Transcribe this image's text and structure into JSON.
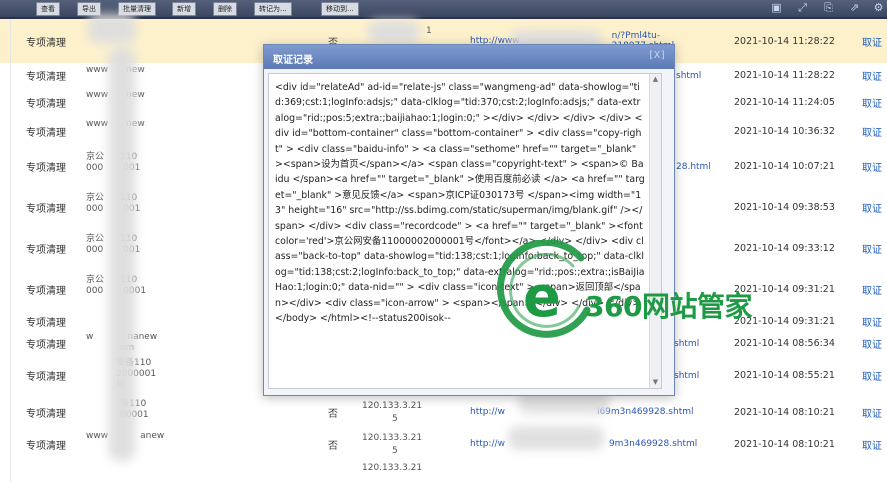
{
  "toolbar": {
    "buttons": [
      "查看",
      "导出",
      "批量清理",
      "新增",
      "删除",
      "转记为...",
      "移动到..."
    ],
    "icons": [
      "save-icon",
      "expand-icon",
      "export-icon",
      "share-icon",
      "settings-icon"
    ]
  },
  "rows": [
    {
      "type": "专项清理",
      "src": "",
      "flag": "否",
      "ip": "",
      "ip2": "1",
      "url": "http://www",
      "url_end": "n/?Pml4tu-218977.shtml",
      "time": "2021-10-14 11:28:22",
      "action": "取证"
    },
    {
      "type": "专项清理",
      "src": "www",
      "src2": "new",
      "flag": "",
      "ip": "",
      "ip2": "",
      "url": "",
      "url_end": "shtml",
      "time": "2021-10-14 11:28:22",
      "action": "取证"
    },
    {
      "type": "专项清理",
      "src": "www",
      "src2": "new",
      "flag": "",
      "ip": "",
      "ip2": "",
      "url": "",
      "url_end": "",
      "time": "2021-10-14 11:24:05",
      "action": "取证"
    },
    {
      "type": "专项清理",
      "src": "www",
      "src2": "new",
      "flag": "",
      "ip": "",
      "ip2": "",
      "url": "",
      "url_end": "",
      "time": "2021-10-14 10:36:32",
      "action": "取证"
    },
    {
      "type": "专项清理",
      "src": "京公",
      "src2": "110",
      "src3": "000",
      "src4": "001",
      "flag": "",
      "ip": "",
      "ip2": "",
      "url": "",
      "url_end": "28.html",
      "time": "2021-10-14 10:07:21",
      "action": "取证"
    },
    {
      "type": "专项清理",
      "src": "京公",
      "src2": "110",
      "src3": "000",
      "src4": "001",
      "flag": "",
      "ip": "",
      "ip2": "",
      "url": "",
      "url_end": "",
      "time": "2021-10-14 09:38:53",
      "action": "取证"
    },
    {
      "type": "专项清理",
      "src": "京公",
      "src2": "110",
      "src3": "000",
      "src4": "001",
      "flag": "",
      "ip": "",
      "ip2": "",
      "url": "",
      "url_end": "",
      "time": "2021-10-14 09:33:12",
      "action": "取证"
    },
    {
      "type": "专项清理",
      "src": "京公",
      "src2": "110",
      "src3": "000",
      "src4": "0001",
      "flag": "",
      "ip": "",
      "ip2": "",
      "url": "",
      "url_end": "",
      "time": "2021-10-14 09:31:21",
      "action": "取证"
    },
    {
      "type": "专项清理",
      "src": "",
      "src2": "",
      "flag": "",
      "ip": "",
      "ip2": "",
      "url": "",
      "url_end": "",
      "time": "2021-10-14 09:31:21",
      "action": "取证"
    },
    {
      "type": "专项清理",
      "src": "w",
      "src2": "nanew",
      "src3": "om",
      "flag": "",
      "ip": "",
      "ip2": "",
      "url": "",
      "url_end": "shtml",
      "time": "2021-10-14 08:56:34",
      "action": "取证"
    },
    {
      "type": "专项清理",
      "src": "安备110",
      "src2": "2000001",
      "src3": "号",
      "flag": "",
      "ip": "",
      "ip2": "",
      "url": "",
      "url_end": "shtml",
      "time": "2021-10-14 08:55:21",
      "action": "取证"
    },
    {
      "type": "专项清理",
      "src": "备110",
      "src2": "00001",
      "flag": "否",
      "ip": "120.133.3.21",
      "ip2": "5",
      "url": "http://w",
      "url_end": "l69m3n469928.shtml",
      "time": "2021-10-14 08:10:21",
      "action": "取证"
    },
    {
      "type": "专项清理",
      "src": "www",
      "src2": "anew",
      "flag": "否",
      "ip": "120.133.3.21",
      "ip2": "5",
      "url": "http://w",
      "url_end": "9m3n469928.shtml",
      "time": "2021-10-14 08:10:21",
      "action": "取证"
    },
    {
      "type": "",
      "src": "",
      "flag": "",
      "ip": "120.133.3.21",
      "ip2": "",
      "url": "",
      "url_end": "",
      "time": "",
      "action": ""
    }
  ],
  "modal": {
    "title": "取证记录",
    "close": "[X]",
    "content": "<div id=\"relateAd\" ad-id=\"relate-js\" class=\"wangmeng-ad\" data-showlog=\"tid:369;cst:1;logInfo:adsjs;\" data-clklog=\"tid:370;cst:2;logInfo:adsjs;\" data-extralog=\"rid:;pos:5;extra:;baijiahao:1;login:0;\" ></div> </div> </div> </div> <div id=\"bottom-container\" class=\"bottom-container\" > <div class=\"copy-right\" > <div class=\"baidu-info\" > <a class=\"sethome\" href=\"\" target=\"_blank\" ><span>设为首页</span></a> <span class=\"copyright-text\" > <span>© Baidu </span><a href=\"\" target=\"_blank\" >使用百度前必读 </a> <a href=\"\" target=\"_blank\" >意见反馈</a> <span>京ICP证030173号 </span><img width=\"13\" height=\"16\" src=\"http://ss.bdimg.com/static/superman/img/blank.gif\" /></span> </div> <div class=\"recordcode\" > <a href=\"\" target=\"_blank\" ><font color='red'>京公网安备11000002000001号</font></a> </div> </div> <div class=\"back-to-top\" data-showlog=\"tid:138;cst:1;logInfo:back_to_top;\" data-clklog=\"tid:138;cst:2;logInfo:back_to_top;\" data-extralog=\"rid:;pos:;extra:;isBaiJiaHao:1;login:0;\" data-nid=\"\" > <div class=\"icon-text\" > <span>返回顶部</span></div> <div class=\"icon-arrow\" > <span></span> </div> </div> </div> </body> </html><!--status200isok--"
  },
  "watermark": {
    "letter": "e",
    "text": "360网站管家",
    "color": "#1f9a44"
  }
}
